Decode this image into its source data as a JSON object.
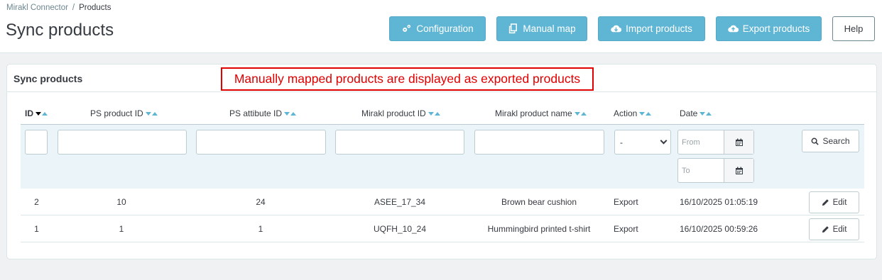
{
  "breadcrumb": {
    "parent": "Mirakl Connector",
    "separator": "/",
    "current": "Products"
  },
  "page": {
    "title": "Sync products"
  },
  "toolbar": {
    "configuration_label": "Configuration",
    "manual_map_label": "Manual map",
    "import_label": "Import products",
    "export_label": "Export products",
    "help_label": "Help"
  },
  "panel": {
    "title": "Sync products",
    "note": "Manually mapped products are displayed as exported products"
  },
  "columns": {
    "id": "ID",
    "ps_product_id": "PS product ID",
    "ps_attribute_id": "PS attibute ID",
    "mirakl_product_id": "Mirakl product ID",
    "mirakl_product_name": "Mirakl product name",
    "action": "Action",
    "date": "Date"
  },
  "filters": {
    "action_selected": "-",
    "date_from_placeholder": "From",
    "date_to_placeholder": "To",
    "search_label": "Search"
  },
  "rows": [
    {
      "id": "2",
      "ps_product_id": "10",
      "ps_attribute_id": "24",
      "mirakl_product_id": "ASEE_17_34",
      "mirakl_product_name": "Brown bear cushion",
      "action": "Export",
      "date": "16/10/2025 01:05:19",
      "edit_label": "Edit"
    },
    {
      "id": "1",
      "ps_product_id": "1",
      "ps_attribute_id": "1",
      "mirakl_product_id": "UQFH_10_24",
      "mirakl_product_name": "Hummingbird printed t-shirt",
      "action": "Export",
      "date": "16/10/2025 00:59:26",
      "edit_label": "Edit"
    }
  ],
  "colors": {
    "accent": "#5fb6d4",
    "note_border": "#e00000"
  }
}
